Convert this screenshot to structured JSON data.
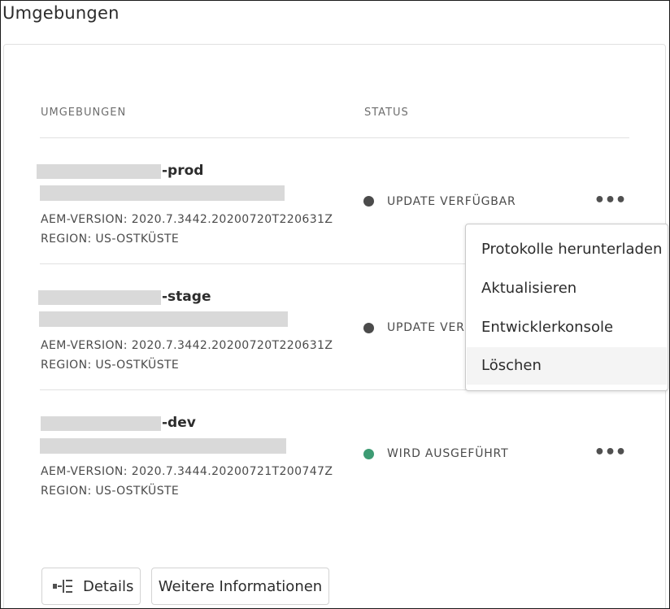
{
  "page": {
    "title": "Umgebungen"
  },
  "table": {
    "columns": [
      "UMGEBUNGEN",
      "STATUS"
    ],
    "rows": [
      {
        "name_suffix": "-prod",
        "aem_version": "AEM-VERSION: 2020.7.3442.20200720T220631Z",
        "region": "REGION: US-OSTKÜSTE",
        "status": "UPDATE VERFÜGBAR",
        "status_color": "#4b4b4b",
        "more_label": "•••"
      },
      {
        "name_suffix": "-stage",
        "aem_version": "AEM-VERSION: 2020.7.3442.20200720T220631Z",
        "region": "REGION: US-OSTKÜSTE",
        "status": "UPDATE VERFÜGBAR",
        "status_color": "#4b4b4b",
        "more_label": "•••"
      },
      {
        "name_suffix": "-dev",
        "aem_version": "AEM-VERSION: 2020.7.3444.20200721T200747Z",
        "region": "REGION: US-OSTKÜSTE",
        "status": "WIRD AUSGEFÜHRT",
        "status_color": "#3d9b73",
        "more_label": "•••"
      }
    ]
  },
  "menu": {
    "items": [
      "Protokolle herunterladen",
      "Aktualisieren",
      "Entwicklerkonsole",
      "Löschen"
    ]
  },
  "footer": {
    "details_label": "Details",
    "more_info_label": "Weitere Informationen"
  },
  "icons": {
    "more": "more-horizontal-icon",
    "details": "tree-view-icon"
  },
  "colors": {
    "status_running": "#3d9b73",
    "status_update": "#4b4b4b",
    "redaction": "#d9d9d9"
  }
}
